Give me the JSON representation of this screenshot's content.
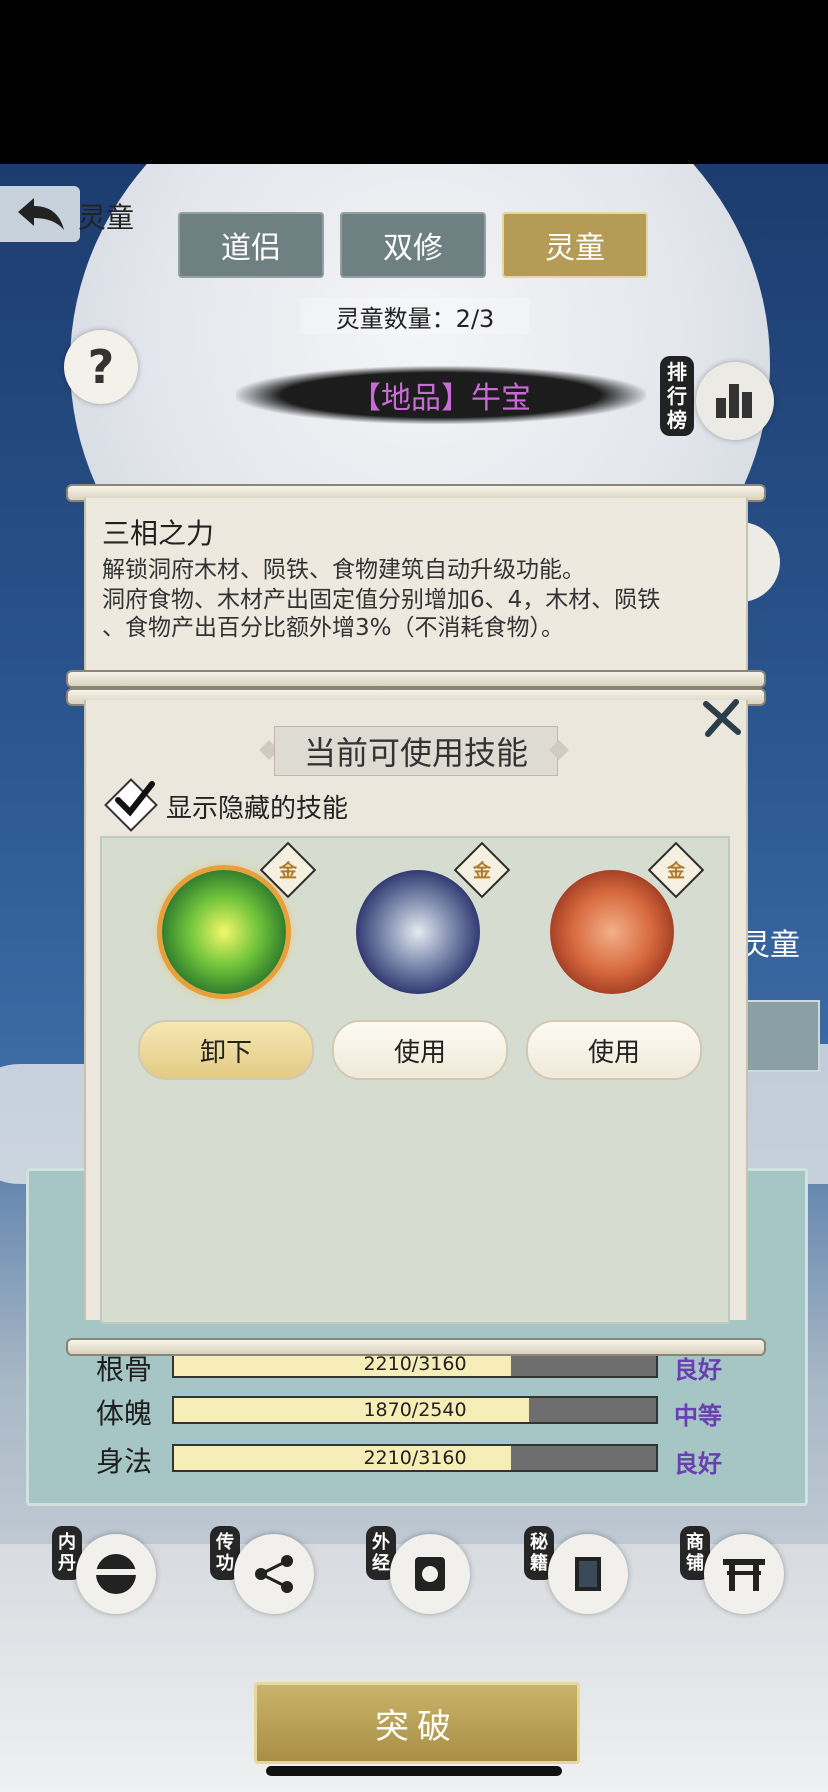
{
  "header": {
    "title": "灵童"
  },
  "tabs": [
    {
      "label": "道侣",
      "active": false
    },
    {
      "label": "双修",
      "active": false
    },
    {
      "label": "灵童",
      "active": true
    }
  ],
  "count_text": "灵童数量：2/3",
  "companion_name": "【地品】牛宝",
  "ranking_label": "排行榜",
  "help_icon": "question-mark",
  "side_text": "灵童",
  "skill_info": {
    "title": "三相之力",
    "lines": [
      "解锁洞府木材、陨铁、食物建筑自动升级功能。",
      "洞府食物、木材产出固定值分别增加6、4，木材、陨铁",
      "、食物产出百分比额外增3%（不消耗食物）。"
    ]
  },
  "skill_panel": {
    "heading": "当前可使用技能",
    "show_hidden_label": "显示隐藏的技能",
    "show_hidden_checked": true,
    "skills": [
      {
        "icon": "green-energy-orb-icon",
        "badge": "金",
        "button": "卸下",
        "equipped": true
      },
      {
        "icon": "silver-crystal-icon",
        "badge": "金",
        "button": "使用",
        "equipped": false
      },
      {
        "icon": "roast-meat-icon",
        "badge": "金",
        "button": "使用",
        "equipped": false
      }
    ]
  },
  "stats": [
    {
      "label": "根骨",
      "value": "2210/3160",
      "ratio": 0.699,
      "grade": "良好"
    },
    {
      "label": "体魄",
      "value": "1870/2540",
      "ratio": 0.736,
      "grade": "中等"
    },
    {
      "label": "身法",
      "value": "2210/3160",
      "ratio": 0.699,
      "grade": "良好"
    }
  ],
  "bottom_nav": [
    {
      "tag": "内丹",
      "icon": "yin-yang-half-icon"
    },
    {
      "tag": "传功",
      "icon": "share-nodes-icon"
    },
    {
      "tag": "外经",
      "icon": "scroll-taiji-icon"
    },
    {
      "tag": "秘籍",
      "icon": "book-icon"
    },
    {
      "tag": "商铺",
      "icon": "gate-icon"
    }
  ],
  "breakthrough_label": "突破",
  "colors": {
    "gold": "#b49b56",
    "grey_tab": "#6f8083",
    "grade_purple": "#6a3fb4",
    "name_purple": "#c86bd6"
  }
}
